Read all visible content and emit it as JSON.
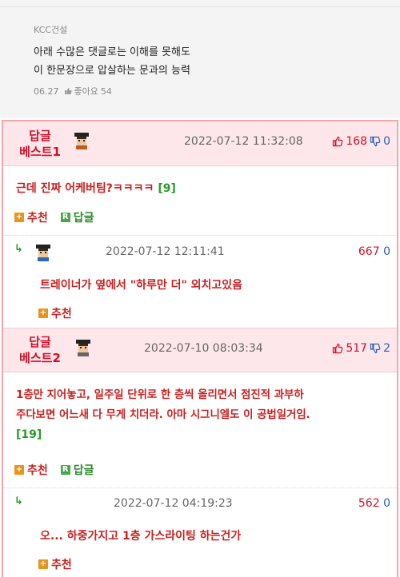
{
  "top_comment": {
    "author": "KCC건설",
    "line1": "아래 수많은 댓글로는 이해를 못해도",
    "line2": "이 한문장으로 압살하는 문과의 능력",
    "date": "06.27",
    "like_label": "좋아요",
    "like_count": "54"
  },
  "best1": {
    "label_line1": "답글",
    "label_line2": "베스트1",
    "timestamp": "2022-07-12 11:32:08",
    "up": "168",
    "down": "0",
    "text": "근데 진짜 어케버팀?ㅋㅋㅋㅋ",
    "reply_count": "[9]",
    "recommend_label": "추천",
    "reply_label": "답글",
    "reply": {
      "arrow": "↳",
      "timestamp": "2022-07-12 12:11:41",
      "up": "667",
      "down": "0",
      "text": "트레이너가 옆에서 \"하루만 더\" 외치고있음",
      "recommend_label": "추천"
    }
  },
  "best2": {
    "label_line1": "답글",
    "label_line2": "베스트2",
    "timestamp": "2022-07-10 08:03:34",
    "up": "517",
    "down": "2",
    "text_line1": "1층만 지어놓고, 일주일 단위로 한 층씩 올리면서 점진적 과부하",
    "text_line2": "주다보면 어느새 다 무게 치더라. 아마 시그니엘도 이 공법일거임.",
    "reply_count": "[19]",
    "recommend_label": "추천",
    "reply_label": "답글",
    "reply": {
      "arrow": "↳",
      "timestamp": "2022-07-12 04:19:23",
      "up": "562",
      "down": "0",
      "text": "오... 하중가지고 1층 가스라이팅 하는건가",
      "recommend_label": "추천"
    }
  },
  "colors": {
    "accent_red": "#d0102a",
    "pink_border": "#f3a6ad",
    "pink_bg": "#fde7ea",
    "reply_green": "#2a9a2a",
    "down_blue": "#2860b4"
  }
}
